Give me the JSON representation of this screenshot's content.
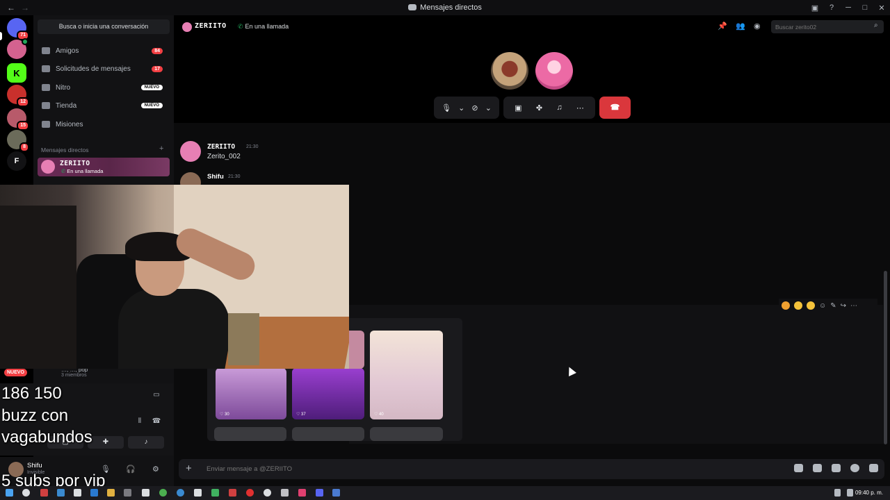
{
  "window": {
    "title": "Mensajes directos"
  },
  "rail": {
    "servers": [
      {
        "name": "discord-home",
        "badge": "71",
        "color": "#5865f2"
      },
      {
        "name": "server-pink",
        "badge": "",
        "color": "#d4628f"
      },
      {
        "name": "server-kick",
        "badge": "",
        "color": "#53fc18",
        "letter": "K"
      },
      {
        "name": "server-red",
        "badge": "12",
        "color": "#c9302c"
      },
      {
        "name": "server-anime",
        "badge": "15",
        "color": "#b85a6a"
      },
      {
        "name": "server-gray",
        "badge": "8",
        "color": "#6b6b5a"
      },
      {
        "name": "server-f",
        "badge": "",
        "color": "#121214",
        "letter": "F"
      }
    ]
  },
  "sidebar": {
    "search_label": "Busca o inicia una conversación",
    "items": [
      {
        "label": "Amigos",
        "badge": "84"
      },
      {
        "label": "Solicitudes de mensajes",
        "badge": "17"
      },
      {
        "label": "Nitro",
        "pill": "NUEVO"
      },
      {
        "label": "Tienda",
        "pill": "NUEVO"
      },
      {
        "label": "Misiones"
      }
    ],
    "dm_header": "Mensajes directos",
    "active_dm": {
      "name": "ZERIITO",
      "status": "En una llamada"
    },
    "nuevo_badge": "NUEVO",
    "group": {
      "name": "…, …, pop",
      "members": "3 miembros"
    }
  },
  "user": {
    "name": "Shifu",
    "status": "Invisible"
  },
  "header": {
    "name": "ZERIITO",
    "status": "En una llamada",
    "search_placeholder": "Buscar zerito02"
  },
  "messages": [
    {
      "author": "ZERIITO",
      "time": "21:30",
      "text": "Zerito_002"
    },
    {
      "author": "Shifu",
      "time": "21:30",
      "text": ""
    }
  ],
  "gallery": {
    "likes": [
      "30",
      "37",
      "40"
    ]
  },
  "composer": {
    "placeholder": "Enviar mensaje a @ZERIITO"
  },
  "overlay": {
    "line1": "186 150",
    "line2": "buzz con",
    "line3": "vagabundos",
    "line4": "5 subs por vip"
  },
  "taskbar": {
    "time": "09:40 p. m."
  },
  "colors": {
    "accent": "#5865f2",
    "danger": "#da373c",
    "online": "#23a55a"
  }
}
